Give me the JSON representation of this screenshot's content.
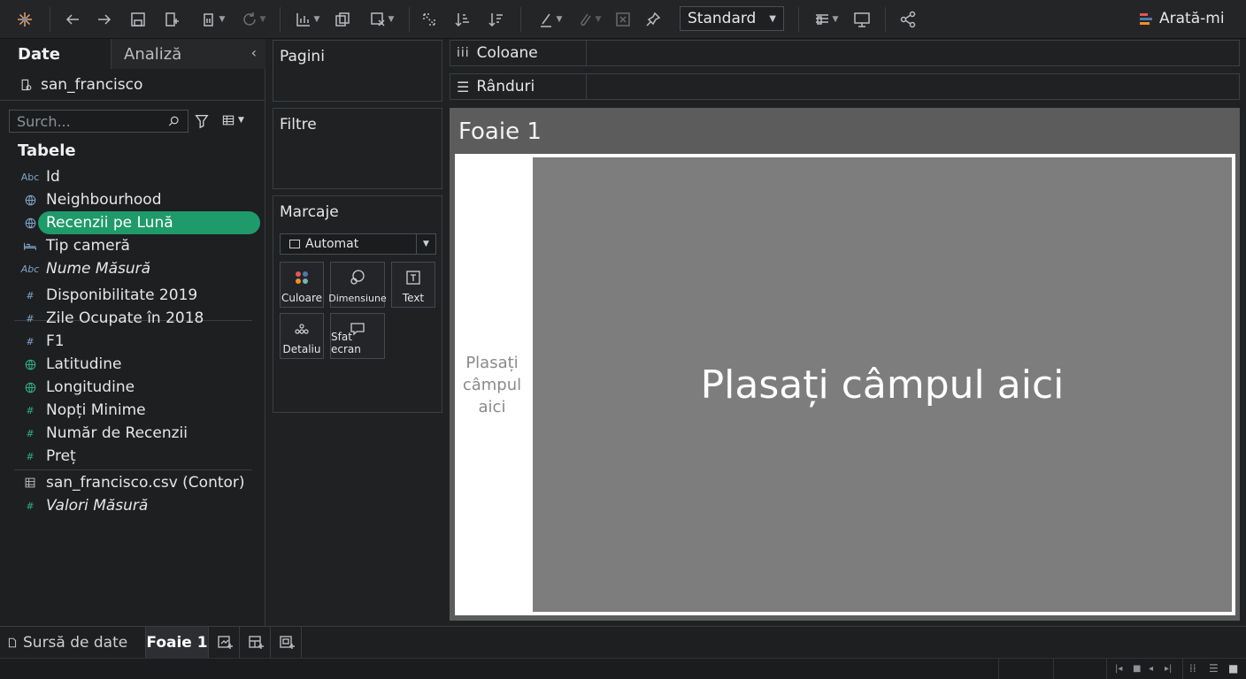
{
  "toolbar": {
    "standard_value": "Standard",
    "show_me_label": "Arată-mi",
    "show_me_colors": [
      "#e15759",
      "#4e79a7",
      "#f28e2b"
    ]
  },
  "data_pane": {
    "tab_data": "Date",
    "tab_analysis": "Analiză",
    "collapse_glyph": "‹",
    "data_source": "san_francisco",
    "search_placeholder": "Surch...",
    "section_title": "Tabele",
    "dimensions": [
      {
        "icon": "Abc",
        "name": "Id"
      },
      {
        "icon": "globe",
        "name": "Neighbourhood"
      },
      {
        "icon": "globe",
        "name": "Recenzii pe Lună",
        "selected": true
      },
      {
        "icon": "bed",
        "name": "Tip cameră"
      },
      {
        "icon": "Abc",
        "name": "Nume Măsură"
      }
    ],
    "measures": [
      {
        "icon": "#",
        "name": "Disponibilitate 2019"
      },
      {
        "icon": "#",
        "name": "Zile Ocupate în 2018"
      },
      {
        "icon": "#",
        "name": "F1"
      },
      {
        "icon": "globe",
        "name": "Latitudine"
      },
      {
        "icon": "globe",
        "name": "Longitudine"
      },
      {
        "icon": "#",
        "name": "Nopți Minime"
      },
      {
        "icon": "#",
        "name": "Număr de Recenzii"
      },
      {
        "icon": "#",
        "name": "Preț"
      }
    ],
    "others": [
      {
        "icon": "table",
        "name": "san_francisco.csv (Contor)"
      },
      {
        "icon": "#",
        "name": "Valori Măsură"
      }
    ],
    "accent_color": "#1f9a6a"
  },
  "shelves": {
    "pages": "Pagini",
    "filters": "Filtre",
    "marks": "Marcaje",
    "marks_type": "Automat",
    "mark_buttons": {
      "color": "Culoare",
      "size": "Dimensiune",
      "text": "Text",
      "detail": "Detaliu",
      "tooltip": "Sfat ecran"
    },
    "columns": "Coloane",
    "rows": "Rânduri"
  },
  "sheet": {
    "title": "Foaie 1",
    "rows_drop_lines": [
      "Plasați",
      "câmpul",
      "aici"
    ],
    "view_drop": "Plasați câmpul aici"
  },
  "bottom_tabs": {
    "data_source": "Sursă de date",
    "sheet": "Foaie 1"
  }
}
